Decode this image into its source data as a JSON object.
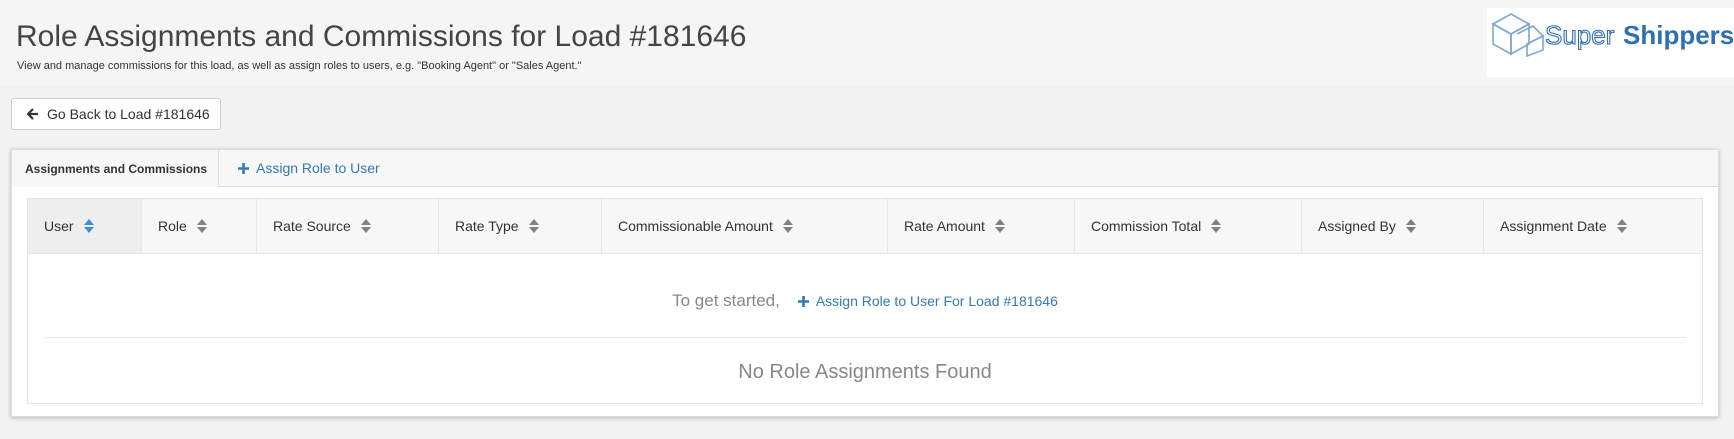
{
  "header": {
    "title": "Role Assignments and Commissions for Load #181646",
    "subtitle": "View and manage commissions for this load, as well as assign roles to users, e.g. \"Booking Agent\" or \"Sales Agent.\""
  },
  "logo": {
    "text_light": "Super",
    "text_bold": "Shippers",
    "icon": "box-logo-icon"
  },
  "back_button": {
    "label": "Go Back to Load #181646",
    "icon": "arrow-left-icon"
  },
  "tabs": {
    "active_label": "Assignments and Commissions",
    "assign_link_label": "Assign Role to User",
    "assign_icon": "plus-icon"
  },
  "table": {
    "columns": [
      "User",
      "Role",
      "Rate Source",
      "Rate Type",
      "Commissionable Amount",
      "Rate Amount",
      "Commission Total",
      "Assigned By",
      "Assignment Date"
    ],
    "sorted_column": "User",
    "get_started_text": "To get started,",
    "get_started_link": "Assign Role to User For Load #181646",
    "empty_message": "No Role Assignments Found"
  },
  "colors": {
    "link": "#337ab7",
    "sort_active": "#3b8fd9",
    "sort_inactive": "#808080",
    "logo_blue": "#2f6fb5"
  }
}
